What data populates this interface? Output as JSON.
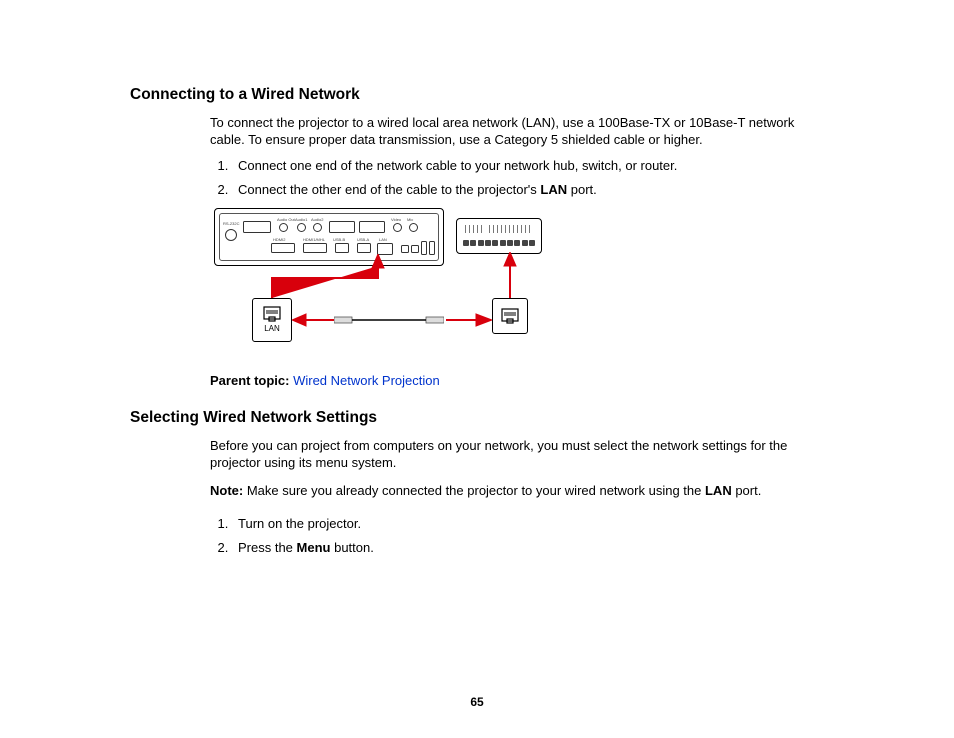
{
  "section1": {
    "heading": "Connecting to a Wired Network",
    "intro": "To connect the projector to a wired local area network (LAN), use a 100Base-TX or 10Base-T network cable. To ensure proper data transmission, use a Category 5 shielded cable or higher.",
    "step1": "Connect one end of the network cable to your network hub, switch, or router.",
    "step2_a": "Connect the other end of the cable to the projector's ",
    "step2_bold": "LAN",
    "step2_b": " port.",
    "lan_label": "LAN",
    "parent_label": "Parent topic: ",
    "parent_link": "Wired Network Projection"
  },
  "section2": {
    "heading": "Selecting Wired Network Settings",
    "intro": "Before you can project from computers on your network, you must select the network settings for the projector using its menu system.",
    "note_label": "Note: ",
    "note_a": "Make sure you already connected the projector to your wired network using the ",
    "note_bold": "LAN",
    "note_b": " port.",
    "step1": "Turn on the projector.",
    "step2_a": "Press the ",
    "step2_bold": "Menu",
    "step2_b": " button."
  },
  "page_number": "65"
}
